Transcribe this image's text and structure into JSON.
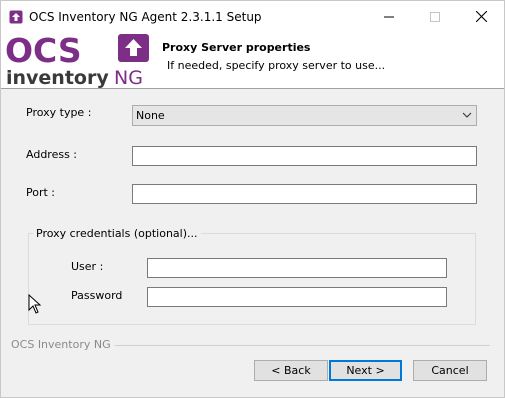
{
  "window": {
    "title": "OCS Inventory NG Agent 2.3.1.1 Setup",
    "controls": {
      "minimize_icon": "minimize-icon",
      "maximize_icon": "maximize-icon",
      "close_icon": "close-icon"
    }
  },
  "header": {
    "logo_top_text": "OCS",
    "logo_bottom_text": "inventory",
    "logo_suffix": "NG",
    "title": "Proxy Server properties",
    "subtitle": "If needed, specify proxy server to use..."
  },
  "form": {
    "proxy_type": {
      "label": "Proxy type :",
      "value": "None"
    },
    "address": {
      "label": "Address :",
      "value": ""
    },
    "port": {
      "label": "Port :",
      "value": ""
    },
    "credentials": {
      "legend": "Proxy credentials (optional)...",
      "user": {
        "label": "User :",
        "value": ""
      },
      "password": {
        "label": "Password",
        "value": ""
      }
    }
  },
  "footer": {
    "brand": "OCS Inventory NG",
    "back_label": "< Back",
    "next_label": "Next >",
    "cancel_label": "Cancel"
  },
  "colors": {
    "brand_purple": "#7d2e86",
    "focus_blue": "#0078d7",
    "panel_bg": "#f0f0f0"
  }
}
